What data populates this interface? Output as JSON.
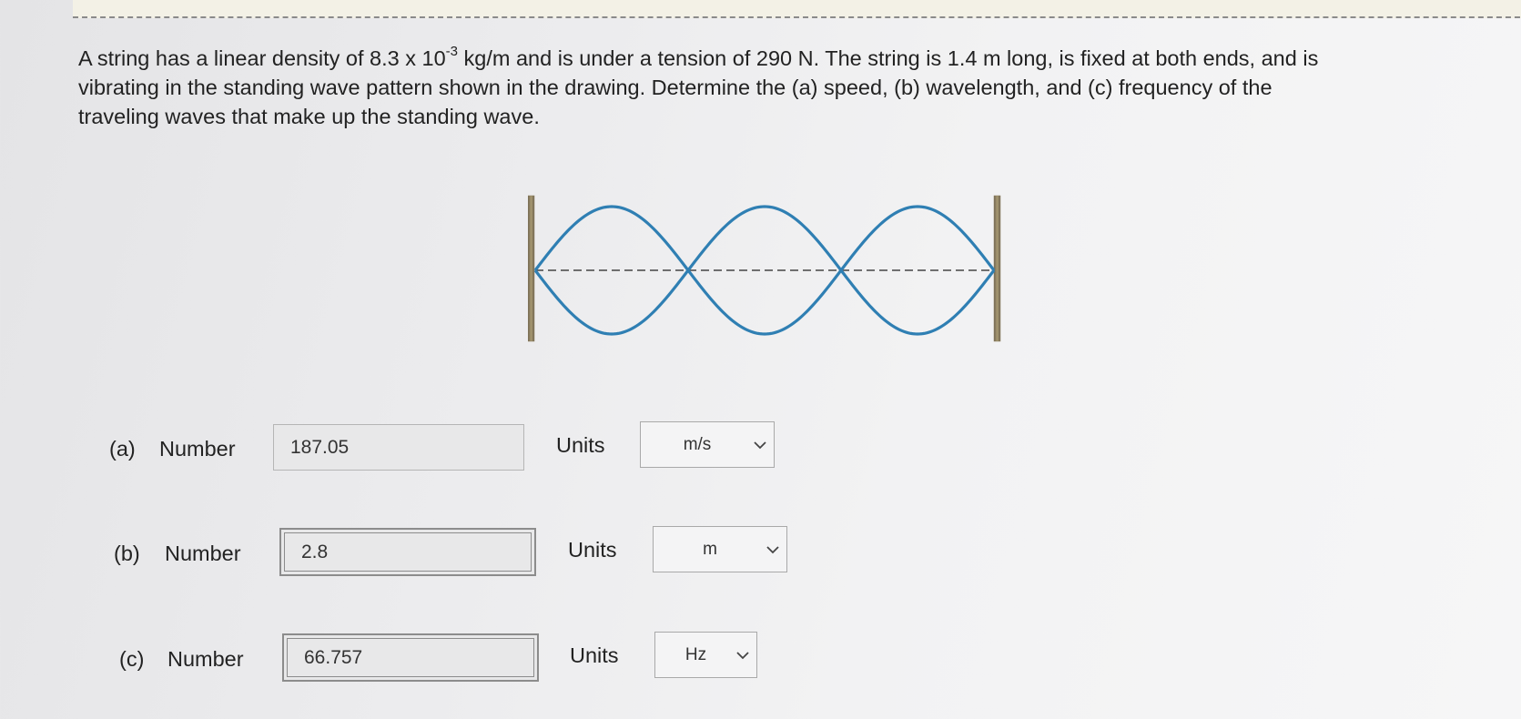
{
  "problem": {
    "line1_a": "A string has a linear density of 8.3 x 10",
    "line1_exp": "-3",
    "line1_b": " kg/m and is under a tension of 290 N. The string is 1.4 m long, is fixed at both ends, and is",
    "line2": "vibrating in the standing wave pattern shown in the drawing. Determine the (a) speed, (b) wavelength, and (c) frequency of the",
    "line3": "traveling waves that make up the standing wave."
  },
  "figure": {
    "loops": 3,
    "wave_color": "#2f7fb3",
    "wall_color": "#8c7f5e"
  },
  "answers": [
    {
      "part": "(a)",
      "number_label": "Number",
      "value": "187.05",
      "units_label": "Units",
      "unit": "m/s"
    },
    {
      "part": "(b)",
      "number_label": "Number",
      "value": "2.8",
      "units_label": "Units",
      "unit": "m"
    },
    {
      "part": "(c)",
      "number_label": "Number",
      "value": "66.757",
      "units_label": "Units",
      "unit": "Hz"
    }
  ]
}
